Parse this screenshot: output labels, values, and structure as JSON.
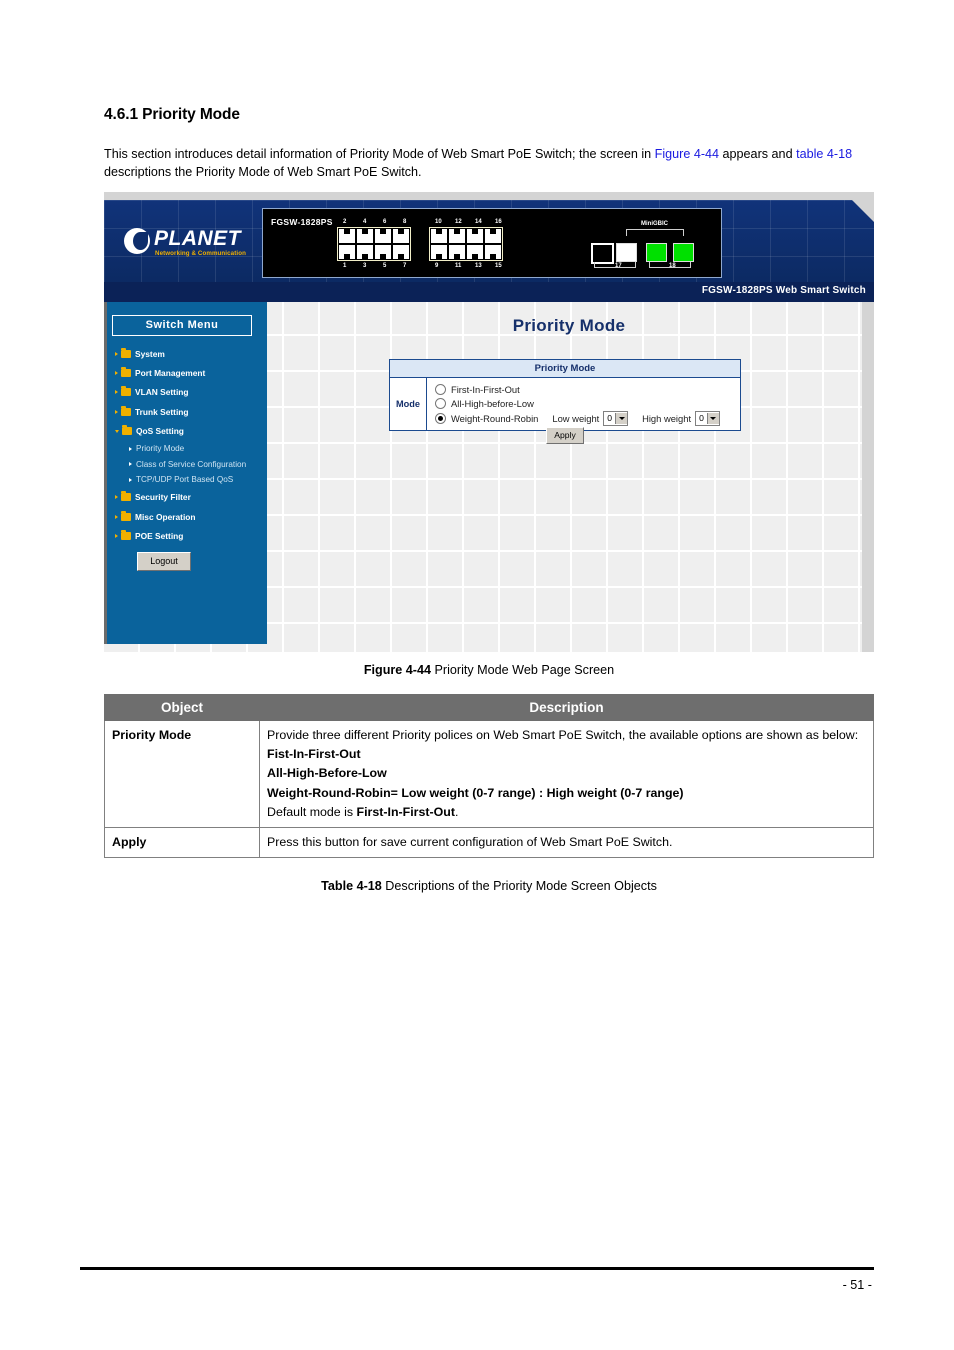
{
  "document": {
    "heading": "4.6.1 Priority Mode",
    "intro": {
      "part1": "This section introduces detail information of Priority Mode of Web Smart PoE Switch; the screen in ",
      "link1": "Figure 4-44",
      "part2": " appears and ",
      "link2": "table 4-18",
      "part3": " descriptions the Priority Mode of Web Smart PoE Switch."
    },
    "figure_caption_label": "Figure 4-44",
    "figure_caption_text": " Priority Mode Web Page Screen",
    "table_caption_label": "Table 4-18",
    "table_caption_text": " Descriptions of the Priority Mode Screen Objects",
    "page_number": "- 51 -"
  },
  "screenshot": {
    "device": {
      "brand": "PLANET",
      "brand_tagline": "Networking & Communication",
      "model": "FGSW-1828PS",
      "footer_title": "FGSW-1828PS Web Smart Switch",
      "port_numbers_top": [
        "2",
        "4",
        "6",
        "8",
        "10",
        "12",
        "14",
        "16"
      ],
      "port_numbers_bottom": [
        "1",
        "3",
        "5",
        "7",
        "9",
        "11",
        "13",
        "15"
      ],
      "sfp_group_label": "MiniGBIC",
      "uplink_label_17": "17",
      "uplink_label_18": "18"
    },
    "sidebar": {
      "title": "Switch Menu",
      "items": [
        {
          "label": "System",
          "expanded": false
        },
        {
          "label": "Port Management",
          "expanded": false
        },
        {
          "label": "VLAN Setting",
          "expanded": false
        },
        {
          "label": "Trunk Setting",
          "expanded": false
        },
        {
          "label": "QoS Setting",
          "expanded": true
        }
      ],
      "submenu": [
        {
          "label": "Priority Mode"
        },
        {
          "label": "Class of Service Configuration"
        },
        {
          "label": "TCP/UDP Port Based QoS"
        }
      ],
      "items_after": [
        {
          "label": "Security Filter",
          "expanded": false
        },
        {
          "label": "Misc Operation",
          "expanded": false
        },
        {
          "label": "POE Setting",
          "expanded": false
        }
      ],
      "logout_label": "Logout"
    },
    "main": {
      "page_title": "Priority Mode",
      "panel_title": "Priority Mode",
      "mode_label": "Mode",
      "options": [
        {
          "label": "First-In-First-Out",
          "selected": false
        },
        {
          "label": "All-High-before-Low",
          "selected": false
        },
        {
          "label": "Weight-Round-Robin",
          "selected": true
        }
      ],
      "low_weight_label": "Low weight",
      "low_weight_value": "0",
      "high_weight_label": "High weight",
      "high_weight_value": "0",
      "apply_label": "Apply"
    }
  },
  "table": {
    "headers": [
      "Object",
      "Description"
    ],
    "rows": [
      {
        "object": "Priority Mode",
        "desc_line1": "Provide three different Priority polices on Web Smart PoE Switch, the available options are shown as below:",
        "desc_bold1": "Fist-In-First-Out",
        "desc_bold2": "All-High-Before-Low",
        "desc_bold3": "Weight-Round-Robin= Low weight (0-7 range) : High weight (0-7 range)",
        "desc_default_pre": "Default mode is ",
        "desc_default_bold": "First-In-First-Out",
        "desc_default_post": "."
      },
      {
        "object": "Apply",
        "desc_line1": "Press this button for save current configuration of Web Smart PoE Switch."
      }
    ]
  },
  "colors": {
    "sidebar_blue": "#0a639c",
    "banner_navy": "#0d2d6b",
    "table_header_gray": "#6e6e6e",
    "link_blue": "#1a1ae0",
    "accent_yellow": "#f0b000",
    "panel_header_blue": "#dbe7f5"
  }
}
